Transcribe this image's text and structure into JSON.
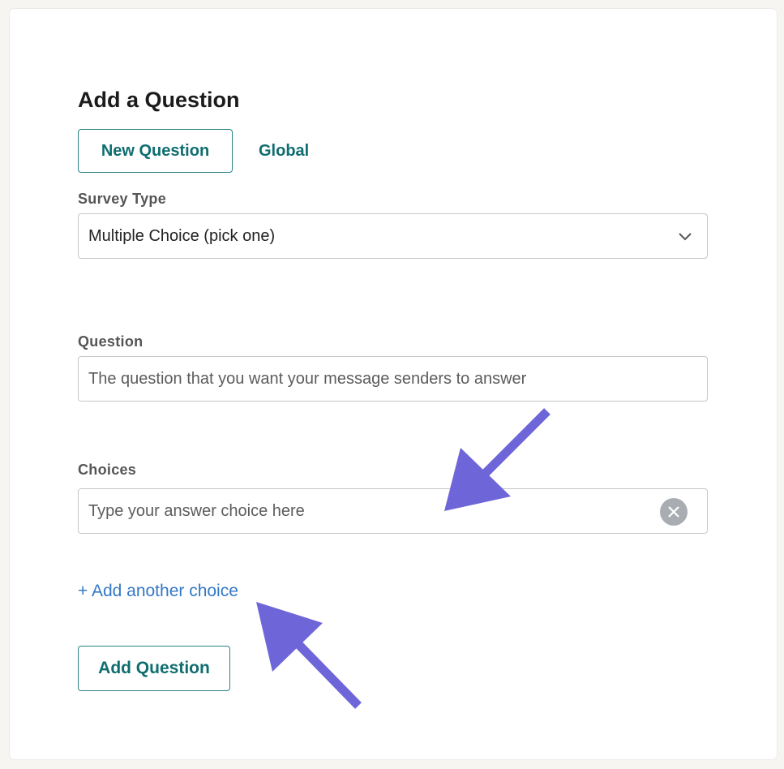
{
  "form": {
    "heading": "Add a Question",
    "tabs": [
      {
        "label": "New Question",
        "active": true
      },
      {
        "label": "Global",
        "active": false
      }
    ],
    "survey_type": {
      "label": "Survey Type",
      "selected": "Multiple Choice (pick one)",
      "icon": "chevron-down-icon"
    },
    "question": {
      "label": "Question",
      "placeholder": "The question that you want your message senders to answer"
    },
    "choices": {
      "label": "Choices",
      "placeholder": "Type your answer choice here",
      "clear_icon": "close-circle-icon"
    },
    "add_choice_label": "+ Add another choice",
    "submit_label": "Add Question"
  },
  "annotations": {
    "arrow_color": "#6e66d8"
  },
  "colors": {
    "accent": "#0f6d6f",
    "link": "#3478c6",
    "background": "#f6f5f1"
  }
}
